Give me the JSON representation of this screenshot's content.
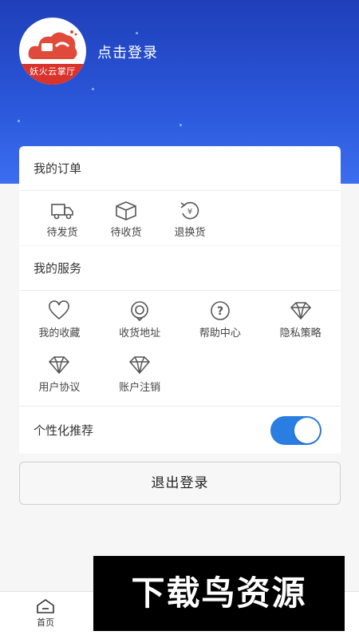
{
  "header": {
    "logo_text": "妖火云掌厅",
    "login_label": "点击登录"
  },
  "orders": {
    "title": "我的订单",
    "items": [
      {
        "label": "待发货",
        "icon": "truck-icon"
      },
      {
        "label": "待收货",
        "icon": "package-icon"
      },
      {
        "label": "退换货",
        "icon": "refund-icon"
      }
    ]
  },
  "services": {
    "title": "我的服务",
    "items": [
      {
        "label": "我的收藏",
        "icon": "heart-icon"
      },
      {
        "label": "收货地址",
        "icon": "location-pin-icon"
      },
      {
        "label": "帮助中心",
        "icon": "question-icon"
      },
      {
        "label": "隐私策略",
        "icon": "diamond-icon"
      },
      {
        "label": "用户协议",
        "icon": "diamond-icon"
      },
      {
        "label": "账户注销",
        "icon": "diamond-icon"
      }
    ]
  },
  "personalized": {
    "label": "个性化推荐",
    "enabled": true
  },
  "logout_label": "退出登录",
  "tabbar": {
    "home_label": "首页"
  },
  "watermark_text": "下载鸟资源",
  "colors": {
    "header_blue": "#2a56d8",
    "switch_on": "#2a7de1",
    "logo_red": "#d8342c"
  }
}
